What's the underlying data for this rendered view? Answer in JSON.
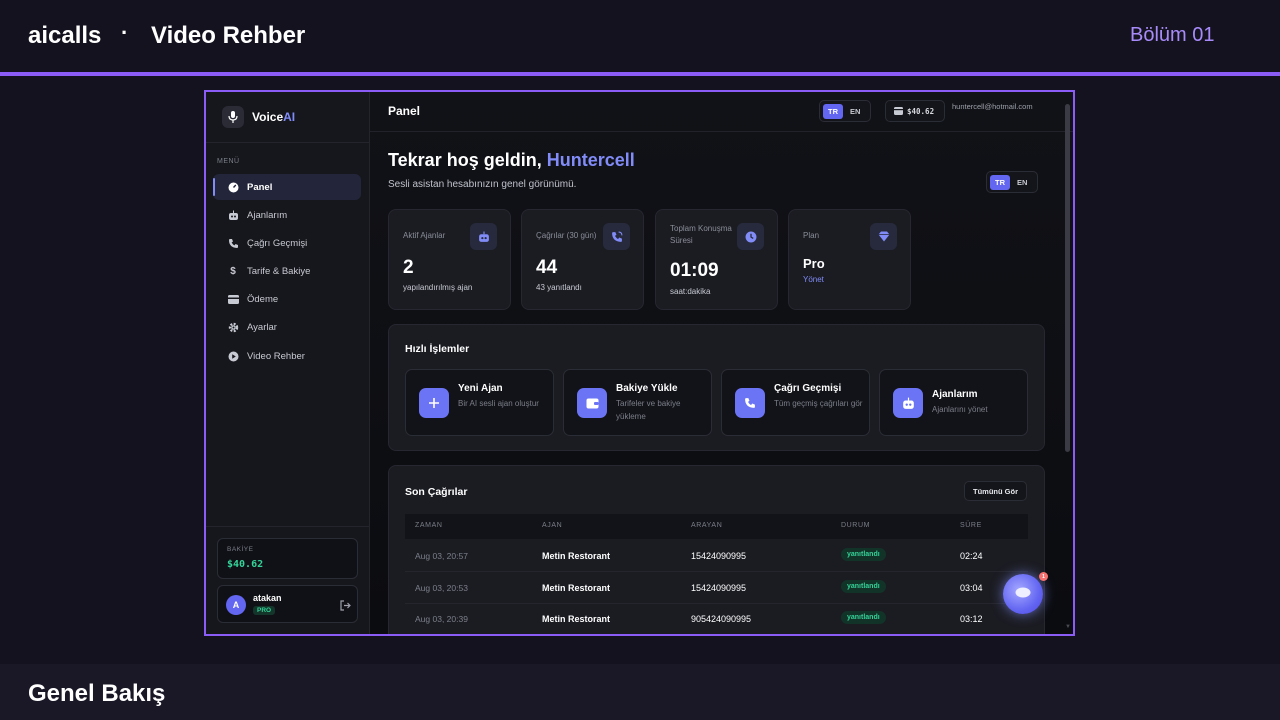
{
  "header": {
    "brand": "aicalls",
    "separator": "·",
    "title": "Video Rehber",
    "chapter": "Bölüm 01"
  },
  "footer": {
    "title": "Genel Bakış"
  },
  "sidebar": {
    "logo_main": "Voice",
    "logo_accent": "AI",
    "menu_label": "MENÜ",
    "items": [
      {
        "label": "Panel",
        "icon": "gauge-icon"
      },
      {
        "label": "Ajanlarım",
        "icon": "robot-icon"
      },
      {
        "label": "Çağrı Geçmişi",
        "icon": "phone-icon"
      },
      {
        "label": "Tarife & Bakiye",
        "icon": "dollar-icon"
      },
      {
        "label": "Ödeme",
        "icon": "card-icon"
      },
      {
        "label": "Ayarlar",
        "icon": "gear-icon"
      },
      {
        "label": "Video Rehber",
        "icon": "play-icon"
      }
    ],
    "balance_label": "BAKİYE",
    "balance_value": "$40.62",
    "user": {
      "initial": "A",
      "name": "atakan",
      "plan": "PRO"
    }
  },
  "topbar": {
    "title": "Panel",
    "lang_tr": "TR",
    "lang_en": "EN",
    "balance": "$40.62",
    "email": "huntercell@hotmail.com"
  },
  "welcome": {
    "greeting": "Tekrar hoş geldin, ",
    "name": "Huntercell",
    "subtitle": "Sesli asistan hesabınızın genel görünümü.",
    "lang_tr": "TR",
    "lang_en": "EN"
  },
  "stats": [
    {
      "label": "Aktif Ajanlar",
      "value": "2",
      "sub": "yapılandırılmış ajan",
      "icon": "robot-icon"
    },
    {
      "label": "Çağrılar (30 gün)",
      "value": "44",
      "sub": "43 yanıtlandı",
      "icon": "phone-call-icon"
    },
    {
      "label": "Toplam Konuşma Süresi",
      "value": "01:09",
      "sub": "saat:dakika",
      "icon": "clock-icon"
    },
    {
      "label": "Plan",
      "value": "Pro",
      "sub": "Yönet",
      "icon": "diamond-icon"
    }
  ],
  "quick_actions": {
    "title": "Hızlı İşlemler",
    "items": [
      {
        "title": "Yeni Ajan",
        "desc": "Bir AI sesli ajan oluştur",
        "icon": "plus-icon"
      },
      {
        "title": "Bakiye Yükle",
        "desc": "Tarifeler ve bakiye yükleme",
        "icon": "wallet-icon"
      },
      {
        "title": "Çağrı Geçmişi",
        "desc": "Tüm geçmiş çağrıları gör",
        "icon": "phone-icon"
      },
      {
        "title": "Ajanlarım",
        "desc": "Ajanlarını yönet",
        "icon": "robot-icon"
      }
    ]
  },
  "recent_calls": {
    "title": "Son Çağrılar",
    "view_all": "Tümünü Gör",
    "columns": [
      "ZAMAN",
      "AJAN",
      "ARAYAN",
      "DURUM",
      "SÜRE"
    ],
    "rows": [
      {
        "time": "Aug 03, 20:57",
        "agent": "Metin Restorant",
        "caller": "15424090995",
        "status": "yanıtlandı",
        "duration": "02:24"
      },
      {
        "time": "Aug 03, 20:53",
        "agent": "Metin Restorant",
        "caller": "15424090995",
        "status": "yanıtlandı",
        "duration": "03:04"
      },
      {
        "time": "Aug 03, 20:39",
        "agent": "Metin Restorant",
        "caller": "905424090995",
        "status": "yanıtlandı",
        "duration": "03:12"
      }
    ]
  },
  "chat": {
    "badge": "1"
  },
  "colors": {
    "accent": "#8b5cf6",
    "brand": "#818cf8",
    "success": "#34d399"
  }
}
